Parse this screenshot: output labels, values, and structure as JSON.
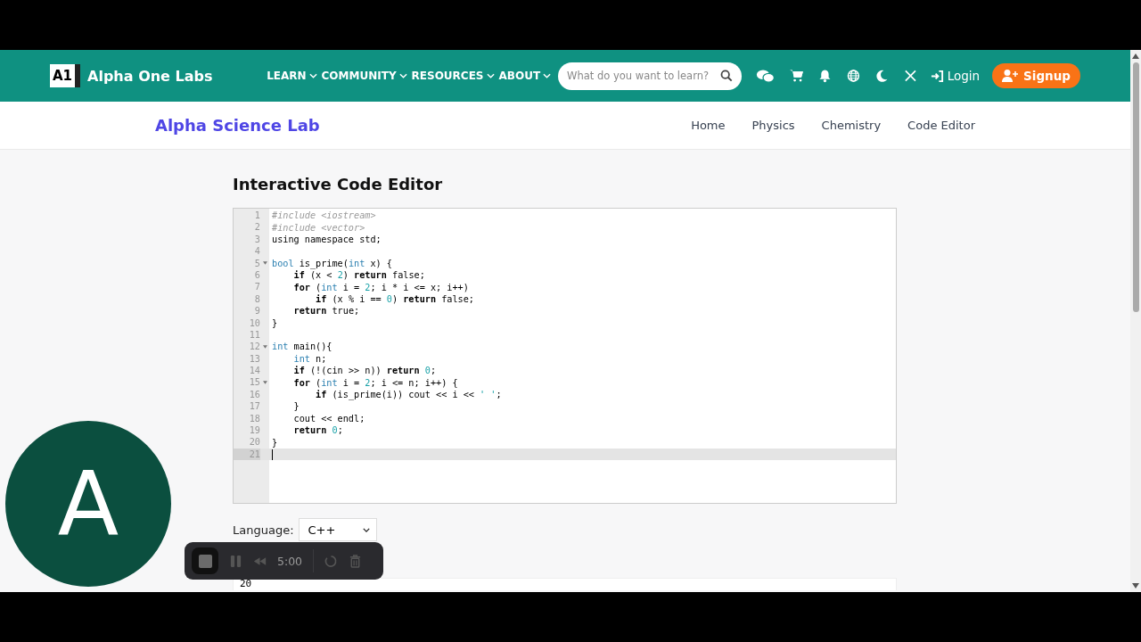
{
  "brand": {
    "logo": "A1",
    "name": "Alpha One Labs"
  },
  "nav": [
    {
      "label": "LEARN"
    },
    {
      "label": "COMMUNITY"
    },
    {
      "label": "RESOURCES"
    },
    {
      "label": "ABOUT"
    }
  ],
  "search": {
    "placeholder": "What do you want to learn?"
  },
  "login": "Login",
  "signup": "Signup",
  "subnav": {
    "title": "Alpha Science Lab",
    "links": [
      "Home",
      "Physics",
      "Chemistry",
      "Code Editor"
    ]
  },
  "heading": "Interactive Code Editor",
  "editor": {
    "lines": [
      {
        "number": "1",
        "fold": false,
        "active": false,
        "tokens": [
          {
            "kind": "comment",
            "t": "#include <iostream>"
          }
        ]
      },
      {
        "number": "2",
        "fold": false,
        "active": false,
        "tokens": [
          {
            "kind": "comment",
            "t": "#include <vector>"
          }
        ]
      },
      {
        "number": "3",
        "fold": false,
        "active": false,
        "tokens": [
          {
            "kind": "plain",
            "t": "using namespace std;"
          }
        ]
      },
      {
        "number": "4",
        "fold": false,
        "active": false
      },
      {
        "number": "5",
        "fold": true,
        "active": false,
        "tokens": [
          {
            "kind": "type",
            "t": "bool"
          },
          {
            "kind": "plain",
            "t": " is_prime("
          },
          {
            "kind": "type",
            "t": "int"
          },
          {
            "kind": "plain",
            "t": " x) {"
          }
        ]
      },
      {
        "number": "6",
        "fold": false,
        "active": false,
        "tokens": [
          {
            "kind": "keyword",
            "t": "    if"
          },
          {
            "kind": "plain",
            "t": " (x < "
          },
          {
            "kind": "number",
            "t": "2"
          },
          {
            "kind": "plain",
            "t": ") "
          },
          {
            "kind": "keyword",
            "t": "return"
          },
          {
            "kind": "plain",
            "t": " false;"
          }
        ]
      },
      {
        "number": "7",
        "fold": false,
        "active": false,
        "tokens": [
          {
            "kind": "keyword",
            "t": "    for"
          },
          {
            "kind": "plain",
            "t": " ("
          },
          {
            "kind": "type",
            "t": "int"
          },
          {
            "kind": "plain",
            "t": " i = "
          },
          {
            "kind": "number",
            "t": "2"
          },
          {
            "kind": "plain",
            "t": "; i * i <= x; i++)"
          }
        ]
      },
      {
        "number": "8",
        "fold": false,
        "active": false,
        "tokens": [
          {
            "kind": "keyword",
            "t": "        if"
          },
          {
            "kind": "plain",
            "t": " (x % i == "
          },
          {
            "kind": "number",
            "t": "0"
          },
          {
            "kind": "plain",
            "t": ") "
          },
          {
            "kind": "keyword",
            "t": "return"
          },
          {
            "kind": "plain",
            "t": " false;"
          }
        ]
      },
      {
        "number": "9",
        "fold": false,
        "active": false,
        "tokens": [
          {
            "kind": "keyword",
            "t": "    return"
          },
          {
            "kind": "plain",
            "t": " true;"
          }
        ]
      },
      {
        "number": "10",
        "fold": false,
        "active": false,
        "tokens": [
          {
            "kind": "plain",
            "t": "}"
          }
        ]
      },
      {
        "number": "11",
        "fold": false,
        "active": false
      },
      {
        "number": "12",
        "fold": true,
        "active": false,
        "tokens": [
          {
            "kind": "type",
            "t": "int"
          },
          {
            "kind": "plain",
            "t": " main(){"
          }
        ]
      },
      {
        "number": "13",
        "fold": false,
        "active": false,
        "tokens": [
          {
            "kind": "type",
            "t": "    int"
          },
          {
            "kind": "plain",
            "t": " n;"
          }
        ]
      },
      {
        "number": "14",
        "fold": false,
        "active": false,
        "tokens": [
          {
            "kind": "keyword",
            "t": "    if"
          },
          {
            "kind": "plain",
            "t": " (!(cin >> n)) "
          },
          {
            "kind": "keyword",
            "t": "return"
          },
          {
            "kind": "number",
            "t": " 0"
          },
          {
            "kind": "plain",
            "t": ";"
          }
        ]
      },
      {
        "number": "15",
        "fold": true,
        "active": false,
        "tokens": [
          {
            "kind": "keyword",
            "t": "    for"
          },
          {
            "kind": "plain",
            "t": " ("
          },
          {
            "kind": "type",
            "t": "int"
          },
          {
            "kind": "plain",
            "t": " i = "
          },
          {
            "kind": "number",
            "t": "2"
          },
          {
            "kind": "plain",
            "t": "; i <= n; i++) {"
          }
        ]
      },
      {
        "number": "16",
        "fold": false,
        "active": false,
        "tokens": [
          {
            "kind": "keyword",
            "t": "        if"
          },
          {
            "kind": "plain",
            "t": " (is_prime(i)) cout << i << "
          },
          {
            "kind": "string",
            "t": "' '"
          },
          {
            "kind": "plain",
            "t": ";"
          }
        ]
      },
      {
        "number": "17",
        "fold": false,
        "active": false,
        "tokens": [
          {
            "kind": "plain",
            "t": "    }"
          }
        ]
      },
      {
        "number": "18",
        "fold": false,
        "active": false,
        "tokens": [
          {
            "kind": "plain",
            "t": "    cout << endl;"
          }
        ]
      },
      {
        "number": "19",
        "fold": false,
        "active": false,
        "tokens": [
          {
            "kind": "keyword",
            "t": "    return"
          },
          {
            "kind": "number",
            "t": " 0"
          },
          {
            "kind": "plain",
            "t": ";"
          }
        ]
      },
      {
        "number": "20",
        "fold": false,
        "active": false,
        "tokens": [
          {
            "kind": "plain",
            "t": "}"
          }
        ]
      },
      {
        "number": "21",
        "fold": false,
        "active": true
      }
    ]
  },
  "language": {
    "label": "Language:",
    "value": "C++"
  },
  "input": {
    "value": "20"
  },
  "avatar": {
    "letter": "A"
  },
  "recorder": {
    "time": "5:00"
  }
}
